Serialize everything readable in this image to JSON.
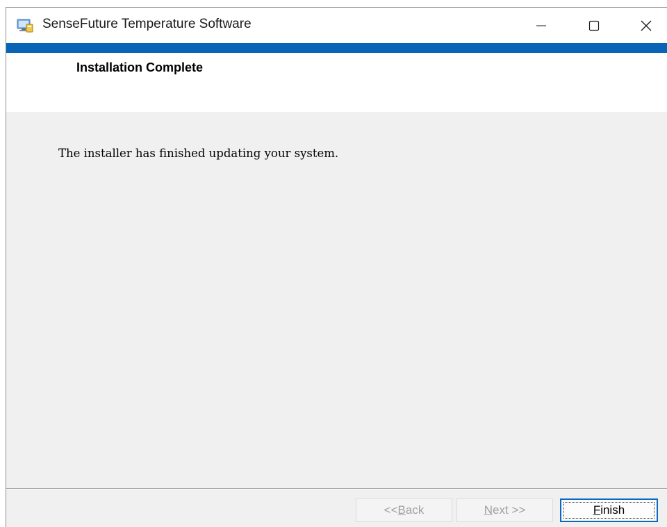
{
  "window": {
    "title": "SenseFuture Temperature Software",
    "icon": "installer-app-icon",
    "controls": {
      "minimize": "minimize-icon",
      "maximize": "maximize-icon",
      "close": "close-icon"
    }
  },
  "header": {
    "title": "Installation Complete"
  },
  "body": {
    "message": "The installer has finished updating your system."
  },
  "footer": {
    "back": {
      "prefix": "<< ",
      "mnemonic": "B",
      "rest": "ack",
      "enabled": false
    },
    "next": {
      "mnemonic": "N",
      "rest": "ext >>",
      "enabled": false
    },
    "finish": {
      "mnemonic": "F",
      "rest": "inish",
      "enabled": true
    }
  },
  "colors": {
    "accent_bar": "#0864b4",
    "content_background": "#f0f0f0",
    "focus_border": "#0a67c2",
    "disabled_text": "#a0a0a0"
  }
}
